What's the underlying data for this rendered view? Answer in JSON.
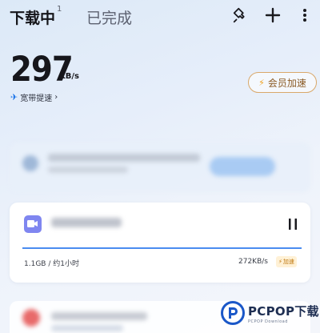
{
  "header": {
    "tab_downloading": "下载中",
    "tab_downloading_count": "1",
    "tab_completed": "已完成",
    "icons": [
      "pin-icon",
      "plus-icon",
      "more-vertical-icon"
    ]
  },
  "speed": {
    "value": "297",
    "unit": "KB/s",
    "broadband_label": "宽带提速",
    "broadband_chevron": "›"
  },
  "member_button": {
    "label": "会员加速",
    "icon": "lightning-icon"
  },
  "download_item": {
    "size_info": "1.1GB / 约1小时",
    "rate": "272KB/s",
    "boost_badge": "加速",
    "progress_fraction": 1.0
  },
  "colors": {
    "accent_blue": "#4a8cf0",
    "member_border": "#d9a86a",
    "member_text": "#8b5a24",
    "boost_text": "#c07a12",
    "file_icon": "#7f86f0"
  },
  "watermark": {
    "brand": "PCPOP下载",
    "sub": "PCPOP Download"
  }
}
